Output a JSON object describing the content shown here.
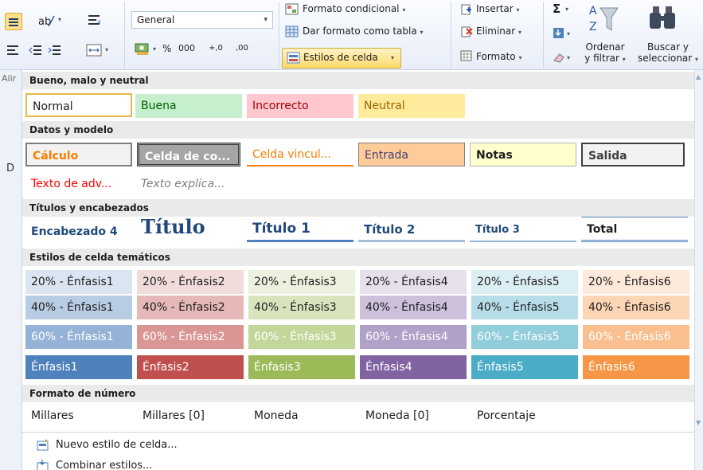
{
  "ribbon": {
    "number_format": "General",
    "percent": "%",
    "thousands": "000",
    "dec_more": "+,0",
    "dec_less": ",00",
    "conditional_format": "Formato condicional",
    "format_table": "Dar formato como tabla",
    "cell_styles": "Estilos de celda",
    "insert": "Insertar",
    "delete": "Eliminar",
    "format": "Formato",
    "sort_filter_1": "Ordenar",
    "sort_filter_2": "y filtrar",
    "find_select_1": "Buscar y",
    "find_select_2": "seleccionar",
    "align_cut": "Alir",
    "column_letter": "D"
  },
  "sections": {
    "good_bad": "Bueno, malo y neutral",
    "data_model": "Datos y modelo",
    "titles": "Títulos y encabezados",
    "themed": "Estilos de celda temáticos",
    "number_format": "Formato de número"
  },
  "good_bad": [
    "Normal",
    "Buena",
    "Incorrecto",
    "Neutral"
  ],
  "data_model_row1": [
    "Cálculo",
    "Celda de co...",
    "Celda vincul...",
    "Entrada",
    "Notas",
    "Salida"
  ],
  "data_model_row2": [
    "Texto de adv...",
    "Texto explica..."
  ],
  "titles": [
    "Encabezado 4",
    "Título",
    "Título 1",
    "Título 2",
    "Título 3",
    "Total"
  ],
  "themed": {
    "row20": [
      "20% - Énfasis1",
      "20% - Énfasis2",
      "20% - Énfasis3",
      "20% - Énfasis4",
      "20% - Énfasis5",
      "20% - Énfasis6"
    ],
    "row40": [
      "40% - Énfasis1",
      "40% - Énfasis2",
      "40% - Énfasis3",
      "40% - Énfasis4",
      "40% - Énfasis5",
      "40% - Énfasis6"
    ],
    "row60": [
      "60% - Énfasis1",
      "60% - Énfasis2",
      "60% - Énfasis3",
      "60% - Énfasis4",
      "60% - Énfasis5",
      "60% - Énfasis6"
    ],
    "row100": [
      "Énfasis1",
      "Énfasis2",
      "Énfasis3",
      "Énfasis4",
      "Énfasis5",
      "Énfasis6"
    ],
    "colors": {
      "c20": [
        "#dbe5f1",
        "#f2dcdb",
        "#ebf1de",
        "#e5e0ec",
        "#dbeef4",
        "#fde9d9"
      ],
      "c40": [
        "#b8cce4",
        "#e6b8b7",
        "#d8e4bc",
        "#ccc0da",
        "#b7dee8",
        "#fcd5b4"
      ],
      "c60": [
        "#95b3d7",
        "#da9694",
        "#c4d79b",
        "#b1a0c7",
        "#92cddc",
        "#fabf8f"
      ],
      "c100": [
        "#4f81bd",
        "#c0504d",
        "#9bbb59",
        "#8064a2",
        "#4bacc6",
        "#f79646"
      ]
    }
  },
  "number_formats": [
    "Millares",
    "Millares [0]",
    "Moneda",
    "Moneda [0]",
    "Porcentaje"
  ],
  "menu": {
    "new_style": "Nuevo estilo de celda...",
    "merge_styles": "Combinar estilos..."
  }
}
